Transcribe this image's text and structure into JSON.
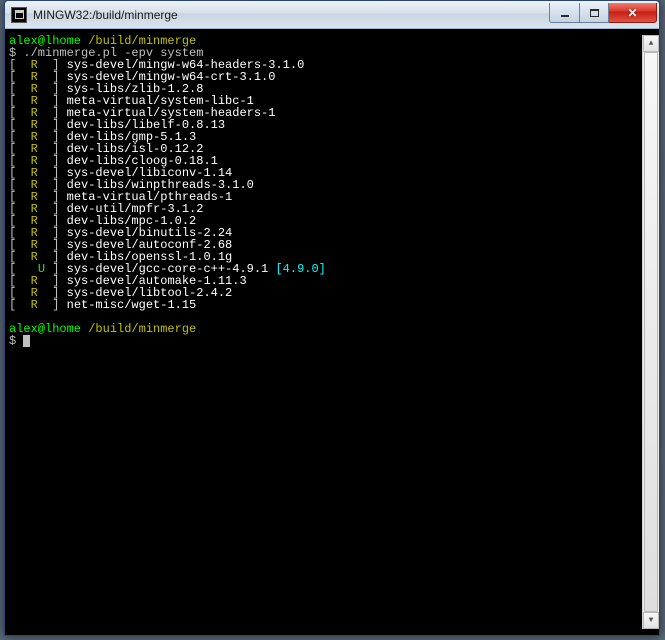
{
  "window": {
    "title": "MINGW32:/build/minmerge"
  },
  "prompt": {
    "user_host": "alex@lhome",
    "path": "/build/minmerge",
    "symbol": "$"
  },
  "command": "./minmerge.pl -epv system",
  "packages": [
    {
      "flag": "R",
      "name": "sys-devel/mingw-w64-headers-3.1.0",
      "extra": ""
    },
    {
      "flag": "R",
      "name": "sys-devel/mingw-w64-crt-3.1.0",
      "extra": ""
    },
    {
      "flag": "R",
      "name": "sys-libs/zlib-1.2.8",
      "extra": ""
    },
    {
      "flag": "R",
      "name": "meta-virtual/system-libc-1",
      "extra": ""
    },
    {
      "flag": "R",
      "name": "meta-virtual/system-headers-1",
      "extra": ""
    },
    {
      "flag": "R",
      "name": "dev-libs/libelf-0.8.13",
      "extra": ""
    },
    {
      "flag": "R",
      "name": "dev-libs/gmp-5.1.3",
      "extra": ""
    },
    {
      "flag": "R",
      "name": "dev-libs/isl-0.12.2",
      "extra": ""
    },
    {
      "flag": "R",
      "name": "dev-libs/cloog-0.18.1",
      "extra": ""
    },
    {
      "flag": "R",
      "name": "sys-devel/libiconv-1.14",
      "extra": ""
    },
    {
      "flag": "R",
      "name": "dev-libs/winpthreads-3.1.0",
      "extra": ""
    },
    {
      "flag": "R",
      "name": "meta-virtual/pthreads-1",
      "extra": ""
    },
    {
      "flag": "R",
      "name": "dev-util/mpfr-3.1.2",
      "extra": ""
    },
    {
      "flag": "R",
      "name": "dev-libs/mpc-1.0.2",
      "extra": ""
    },
    {
      "flag": "R",
      "name": "sys-devel/binutils-2.24",
      "extra": ""
    },
    {
      "flag": "R",
      "name": "sys-devel/autoconf-2.68",
      "extra": ""
    },
    {
      "flag": "R",
      "name": "dev-libs/openssl-1.0.1g",
      "extra": ""
    },
    {
      "flag": "U",
      "name": "sys-devel/gcc-core-c++-4.9.1",
      "extra": "[4.9.0]"
    },
    {
      "flag": "R",
      "name": "sys-devel/automake-1.11.3",
      "extra": ""
    },
    {
      "flag": "R",
      "name": "sys-devel/libtool-2.4.2",
      "extra": ""
    },
    {
      "flag": "R",
      "name": "net-misc/wget-1.15",
      "extra": ""
    }
  ]
}
